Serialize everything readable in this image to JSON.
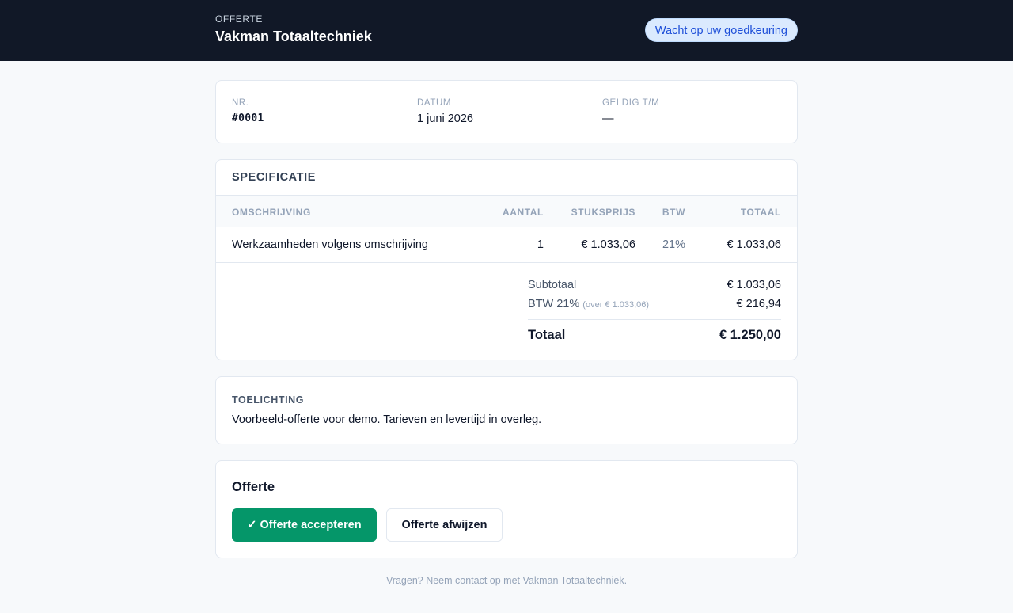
{
  "header": {
    "doc_type": "OFFERTE",
    "company": "Vakman Totaaltechniek",
    "status": "Wacht op uw goedkeuring"
  },
  "meta": {
    "number_label": "NR.",
    "number_value": "#0001",
    "date_label": "DATUM",
    "date_value": "1 juni 2026",
    "valid_label": "GELDIG T/M",
    "valid_value": "—"
  },
  "specification": {
    "title": "SPECIFICATIE",
    "columns": {
      "description": "OMSCHRIJVING",
      "quantity": "AANTAL",
      "unit_price": "STUKSPRIJS",
      "vat": "BTW",
      "total": "TOTAAL"
    },
    "rows": [
      {
        "description": "Werkzaamheden volgens omschrijving",
        "quantity": "1",
        "unit_price": "€ 1.033,06",
        "vat": "21%",
        "total": "€ 1.033,06"
      }
    ],
    "totals": {
      "subtotal_label": "Subtotaal",
      "subtotal_value": "€ 1.033,06",
      "vat_label": "BTW 21%",
      "vat_note": "(over € 1.033,06)",
      "vat_value": "€ 216,94",
      "grand_label": "Totaal",
      "grand_value": "€ 1.250,00"
    }
  },
  "notes": {
    "title": "TOELICHTING",
    "text": "Voorbeeld-offerte voor demo. Tarieven en levertijd in overleg."
  },
  "actions": {
    "title": "Offerte",
    "accept_label": "✓ Offerte accepteren",
    "reject_label": "Offerte afwijzen"
  },
  "footer": {
    "text": "Vragen? Neem contact op met Vakman Totaaltechniek."
  },
  "colors": {
    "header_bg": "#111827",
    "badge_bg": "#dbeafe",
    "badge_text": "#1d4ed8",
    "accept_button": "#059669"
  }
}
